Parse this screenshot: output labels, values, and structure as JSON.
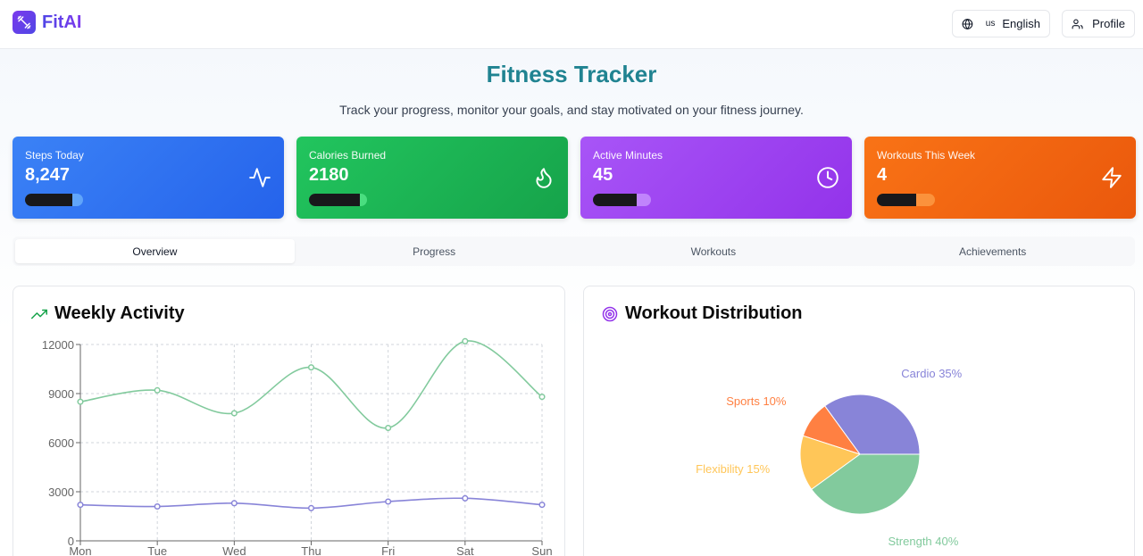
{
  "header": {
    "brand": "FitAI",
    "language_code": "us",
    "language_label": "English",
    "profile_label": "Profile"
  },
  "hero": {
    "title": "Fitness Tracker",
    "subtitle": "Track your progress, monitor your goals, and stay motivated on your fitness journey."
  },
  "stats": [
    {
      "label": "Steps Today",
      "value": "8,247",
      "progress": 0.82,
      "icon": "activity-icon",
      "color": "#3b82f6"
    },
    {
      "label": "Calories Burned",
      "value": "2180",
      "progress": 0.87,
      "icon": "flame-icon",
      "color": "#22c55e"
    },
    {
      "label": "Active Minutes",
      "value": "45",
      "progress": 0.75,
      "icon": "clock-icon",
      "color": "#a855f7"
    },
    {
      "label": "Workouts This Week",
      "value": "4",
      "progress": 0.67,
      "icon": "zap-icon",
      "color": "#f97316"
    }
  ],
  "tabs": [
    {
      "label": "Overview",
      "active": true
    },
    {
      "label": "Progress",
      "active": false
    },
    {
      "label": "Workouts",
      "active": false
    },
    {
      "label": "Achievements",
      "active": false
    }
  ],
  "weekly_activity": {
    "title": "Weekly Activity",
    "icon": "trending-up-icon"
  },
  "workout_distribution": {
    "title": "Workout Distribution",
    "icon": "target-icon"
  },
  "chart_data": [
    {
      "type": "line",
      "title": "Weekly Activity",
      "categories": [
        "Mon",
        "Tue",
        "Wed",
        "Thu",
        "Fri",
        "Sat",
        "Sun"
      ],
      "ylim": [
        0,
        12000
      ],
      "yticks": [
        0,
        3000,
        6000,
        9000,
        12000
      ],
      "grid": true,
      "series": [
        {
          "color": "#82ca9d",
          "values": [
            8500,
            9200,
            7800,
            10600,
            6900,
            12200,
            8800
          ]
        },
        {
          "color": "#8884d8",
          "values": [
            2200,
            2100,
            2300,
            2000,
            2400,
            2600,
            2200
          ]
        }
      ]
    },
    {
      "type": "pie",
      "title": "Workout Distribution",
      "slices": [
        {
          "label": "Cardio",
          "value": 35,
          "text": "Cardio 35%",
          "color": "#8884d8"
        },
        {
          "label": "Sports",
          "value": 10,
          "text": "Sports 10%",
          "color": "#ff8042"
        },
        {
          "label": "Flexibility",
          "value": 15,
          "text": "Flexibility 15%",
          "color": "#ffc658"
        },
        {
          "label": "Strength",
          "value": 40,
          "text": "Strength 40%",
          "color": "#82ca9d"
        }
      ]
    }
  ]
}
